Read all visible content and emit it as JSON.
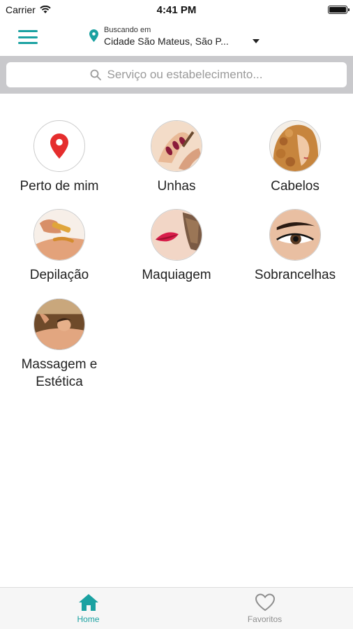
{
  "status_bar": {
    "carrier": "Carrier",
    "time": "4:41 PM"
  },
  "header": {
    "location_label": "Buscando em",
    "location_city": "Cidade São Mateus, São P..."
  },
  "search": {
    "placeholder": "Serviço ou estabelecimento..."
  },
  "categories": [
    {
      "label": "Perto de mim",
      "icon": "location-pin-icon"
    },
    {
      "label": "Unhas",
      "icon": "nails-image"
    },
    {
      "label": "Cabelos",
      "icon": "hair-image"
    },
    {
      "label": "Depilação",
      "icon": "waxing-image"
    },
    {
      "label": "Maquiagem",
      "icon": "makeup-image"
    },
    {
      "label": "Sobrancelhas",
      "icon": "eyebrow-image"
    },
    {
      "label": "Massagem e Estética",
      "icon": "massage-image"
    }
  ],
  "tab_bar": {
    "home": "Home",
    "favorites": "Favoritos"
  },
  "colors": {
    "accent": "#1aa1a1",
    "pin_red": "#e52d2d"
  }
}
